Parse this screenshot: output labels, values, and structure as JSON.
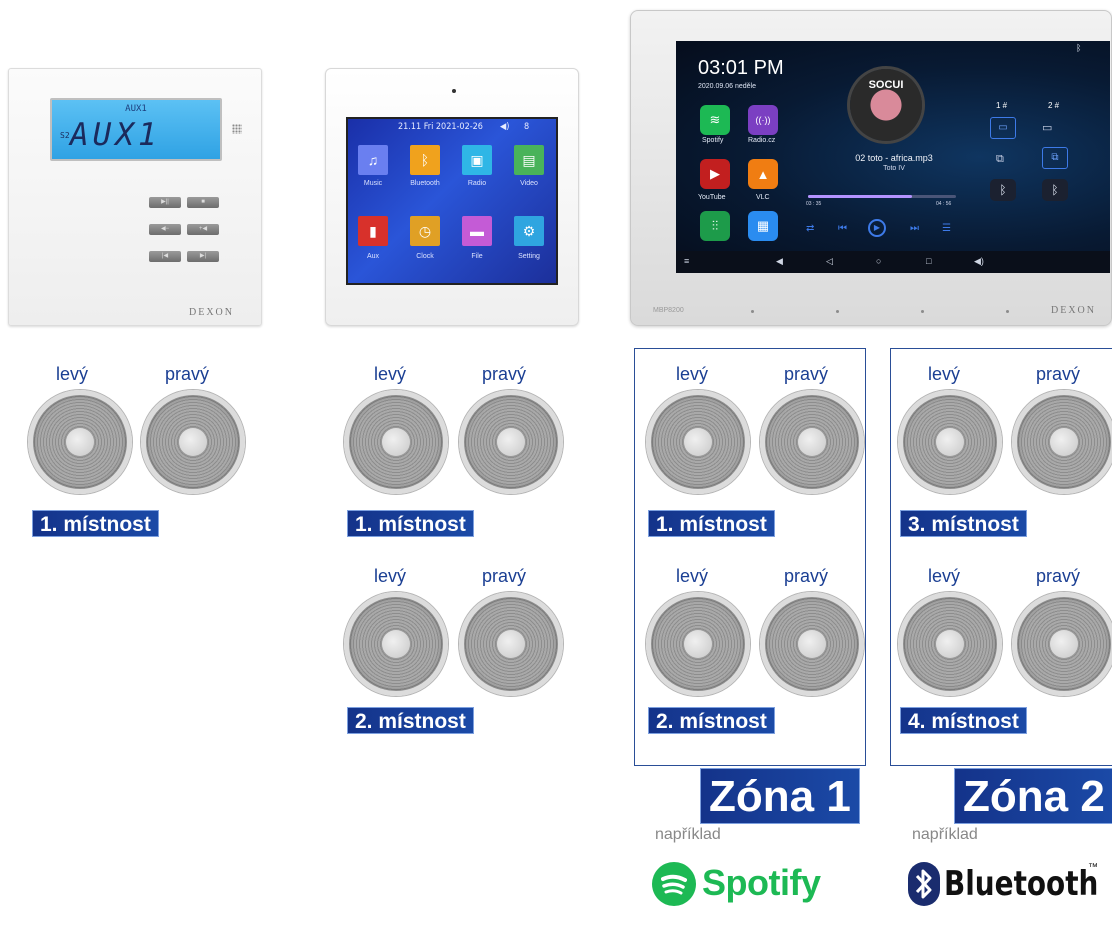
{
  "device1": {
    "lcd_small": "AUX1",
    "lcd_main": "AUX1",
    "lcd_s2": "S2",
    "brand": "DEXON",
    "buttons": [
      "▶||",
      "■",
      "◀−",
      "+◀",
      "|◀",
      "▶|"
    ]
  },
  "device2": {
    "status": "21.11  Fri  2021-02-26",
    "volume": "8",
    "apps": [
      {
        "label": "Music",
        "color": "#6a7ff0",
        "icon": "music-note-icon",
        "glyph": "♫"
      },
      {
        "label": "Bluetooth",
        "color": "#f0a21d",
        "icon": "bluetooth-icon",
        "glyph": "ᛒ"
      },
      {
        "label": "Radio",
        "color": "#2fb6e6",
        "icon": "radio-icon",
        "glyph": "▣"
      },
      {
        "label": "Video",
        "color": "#49b35a",
        "icon": "film-icon",
        "glyph": "▤"
      },
      {
        "label": "Aux",
        "color": "#d8312b",
        "icon": "aux-icon",
        "glyph": "▮"
      },
      {
        "label": "Clock",
        "color": "#e0a025",
        "icon": "clock-icon",
        "glyph": "◷"
      },
      {
        "label": "File",
        "color": "#c45bd6",
        "icon": "folder-icon",
        "glyph": "▬"
      },
      {
        "label": "Setting",
        "color": "#2fa5e0",
        "icon": "gear-icon",
        "glyph": "⚙"
      }
    ]
  },
  "device3": {
    "time": "03:01 PM",
    "date": "2020.09.06 neděle",
    "track": "02 toto - africa.mp3",
    "artist": "Toto IV",
    "elapsed": "03 : 35",
    "total": "04 : 56",
    "progress": 0.7,
    "album_text": "SOCUI",
    "zone1": "1 #",
    "zone2": "2 #",
    "apps": [
      {
        "label": "Spotify",
        "color": "#1db954",
        "icon": "spotify-icon",
        "glyph": "≋"
      },
      {
        "label": "Radio.cz",
        "color": "#7b3fc2",
        "icon": "radio-wave-icon",
        "glyph": "((·))"
      },
      {
        "label": "YouTube",
        "color": "#c21f1f",
        "icon": "youtube-icon",
        "glyph": "▶"
      },
      {
        "label": "VLC",
        "color": "#f07d12",
        "icon": "vlc-icon",
        "glyph": "▲"
      },
      {
        "label": "",
        "color": "#1d9b4a",
        "icon": "equalizer-icon",
        "glyph": "⫶⫶"
      },
      {
        "label": "",
        "color": "#2a8cf0",
        "icon": "apps-grid-icon",
        "glyph": "▦"
      }
    ],
    "model": "MBP8200",
    "brand": "DEXON"
  },
  "labels": {
    "left": "levý",
    "right": "pravý"
  },
  "rooms": {
    "r1": "1. místnost",
    "r2": "2. místnost",
    "r3": "3. místnost",
    "r4": "4. místnost"
  },
  "zones": {
    "z1": "Zóna 1",
    "z2": "Zóna 2"
  },
  "examples": {
    "e1": "například",
    "e2": "například",
    "spotify": "Spotify",
    "bluetooth": "Bluetooth",
    "tm": "™"
  }
}
